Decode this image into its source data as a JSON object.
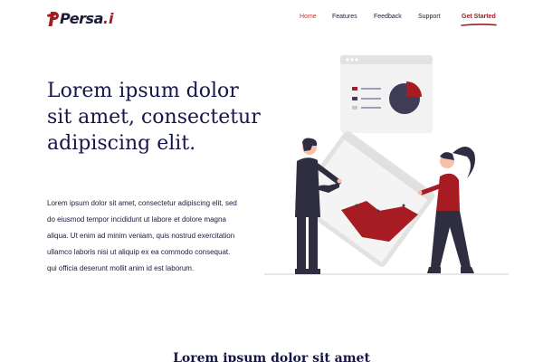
{
  "brand": {
    "name": "Persa",
    "suffix": ".i",
    "accent_color": "#a61c22"
  },
  "nav": {
    "items": [
      {
        "label": "Home",
        "active": true
      },
      {
        "label": "Features",
        "active": false
      },
      {
        "label": "Feedback",
        "active": false
      },
      {
        "label": "Support",
        "active": false
      }
    ],
    "cta_label": "Get Started"
  },
  "hero": {
    "title": "Lorem ipsum dolor sit amet, consectetur adipiscing elit.",
    "body": "Lorem ipsum dolor sit amet, consectetur adipiscing elit, sed do eiusmod tempor incididunt ut labore et dolore magna aliqua. Ut enim ad minim veniam, quis nostrud exercitation ullamco laboris nisi ut aliquip ex ea commodo consequat. qui officia deserunt mollit anim id est laborum."
  },
  "section": {
    "title": "Lorem ipsum dolor sit amet"
  },
  "colors": {
    "primary_dark": "#16164a",
    "accent_red": "#a61c22",
    "link_active": "#c0392b"
  },
  "icons": {
    "logo": "persa-logo-mark",
    "illustration": "presentation-chart-illustration"
  }
}
